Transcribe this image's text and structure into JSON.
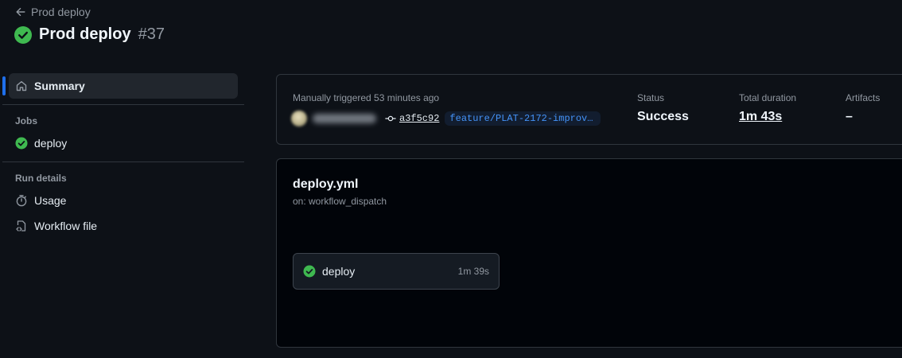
{
  "header": {
    "back_label": "Prod deploy",
    "title": "Prod deploy",
    "run_number": "#37",
    "status_icon": "check-circle-fill-icon"
  },
  "sidebar": {
    "summary_label": "Summary",
    "jobs_heading": "Jobs",
    "jobs": [
      {
        "label": "deploy"
      }
    ],
    "run_details_heading": "Run details",
    "usage_label": "Usage",
    "workflow_file_label": "Workflow file"
  },
  "summary": {
    "trigger_text": "Manually triggered 53 minutes ago",
    "commit": "a3f5c92",
    "branch": "feature/PLAT-2172-improve…",
    "status_label": "Status",
    "status_value": "Success",
    "duration_label": "Total duration",
    "duration_value": "1m 43s",
    "artifacts_label": "Artifacts",
    "artifacts_value": "–"
  },
  "graph": {
    "workflow_file": "deploy.yml",
    "trigger": "on: workflow_dispatch",
    "jobs": [
      {
        "name": "deploy",
        "duration": "1m 39s"
      }
    ]
  },
  "colors": {
    "background": "#0d1117",
    "success": "#3fb950",
    "accent": "#1f6feb",
    "link": "#4493f8"
  }
}
